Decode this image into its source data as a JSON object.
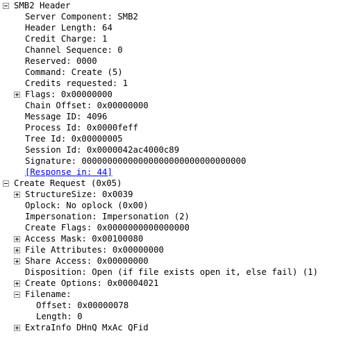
{
  "tree": [
    {
      "level": 0,
      "toggle": "expanded",
      "text": "SMB2 Header",
      "name": "smb2-header-node"
    },
    {
      "level": 1,
      "toggle": "none",
      "text": "Server Component: SMB2",
      "name": "server-component-field"
    },
    {
      "level": 1,
      "toggle": "none",
      "text": "Header Length: 64",
      "name": "header-length-field"
    },
    {
      "level": 1,
      "toggle": "none",
      "text": "Credit Charge: 1",
      "name": "credit-charge-field"
    },
    {
      "level": 1,
      "toggle": "none",
      "text": "Channel Sequence: 0",
      "name": "channel-sequence-field"
    },
    {
      "level": 1,
      "toggle": "none",
      "text": "Reserved: 0000",
      "name": "reserved-field"
    },
    {
      "level": 1,
      "toggle": "none",
      "text": "Command: Create (5)",
      "name": "command-field"
    },
    {
      "level": 1,
      "toggle": "none",
      "text": "Credits requested: 1",
      "name": "credits-requested-field"
    },
    {
      "level": 1,
      "toggle": "collapsed",
      "text": "Flags: 0x00000000",
      "name": "flags-node"
    },
    {
      "level": 1,
      "toggle": "none",
      "text": "Chain Offset: 0x00000000",
      "name": "chain-offset-field"
    },
    {
      "level": 1,
      "toggle": "none",
      "text": "Message ID: 4096",
      "name": "message-id-field"
    },
    {
      "level": 1,
      "toggle": "none",
      "text": "Process Id: 0x0000feff",
      "name": "process-id-field"
    },
    {
      "level": 1,
      "toggle": "none",
      "text": "Tree Id: 0x00000005",
      "name": "tree-id-field"
    },
    {
      "level": 1,
      "toggle": "none",
      "text": "Session Id: 0x0000042ac4000c89",
      "name": "session-id-field"
    },
    {
      "level": 1,
      "toggle": "none",
      "text": "Signature: 00000000000000000000000000000000",
      "name": "signature-field"
    },
    {
      "level": 1,
      "toggle": "none",
      "text": "[Response in: 44]",
      "name": "response-in-link",
      "link": true
    },
    {
      "level": 0,
      "toggle": "expanded",
      "text": "Create Request (0x05)",
      "name": "create-request-node"
    },
    {
      "level": 1,
      "toggle": "collapsed",
      "text": "StructureSize: 0x0039",
      "name": "structure-size-node"
    },
    {
      "level": 1,
      "toggle": "none",
      "text": "Oplock: No oplock (0x00)",
      "name": "oplock-field"
    },
    {
      "level": 1,
      "toggle": "none",
      "text": "Impersonation: Impersonation (2)",
      "name": "impersonation-field"
    },
    {
      "level": 1,
      "toggle": "none",
      "text": "Create Flags: 0x0000000000000000",
      "name": "create-flags-field"
    },
    {
      "level": 1,
      "toggle": "collapsed",
      "text": "Access Mask: 0x00100080",
      "name": "access-mask-node"
    },
    {
      "level": 1,
      "toggle": "collapsed",
      "text": "File Attributes: 0x00000000",
      "name": "file-attributes-node"
    },
    {
      "level": 1,
      "toggle": "collapsed",
      "text": "Share Access: 0x00000000",
      "name": "share-access-node"
    },
    {
      "level": 1,
      "toggle": "none",
      "text": "Disposition: Open (if file exists open it, else fail) (1)",
      "name": "disposition-field"
    },
    {
      "level": 1,
      "toggle": "collapsed",
      "text": "Create Options: 0x00004021",
      "name": "create-options-node"
    },
    {
      "level": 1,
      "toggle": "expanded",
      "text": "Filename:",
      "name": "filename-node"
    },
    {
      "level": 2,
      "toggle": "none",
      "text": "Offset: 0x00000078",
      "name": "filename-offset-field"
    },
    {
      "level": 2,
      "toggle": "none",
      "text": "Length: 0",
      "name": "filename-length-field"
    },
    {
      "level": 1,
      "toggle": "collapsed",
      "text": "ExtraInfo DHnQ MxAc QFid",
      "name": "extrainfo-node"
    }
  ]
}
